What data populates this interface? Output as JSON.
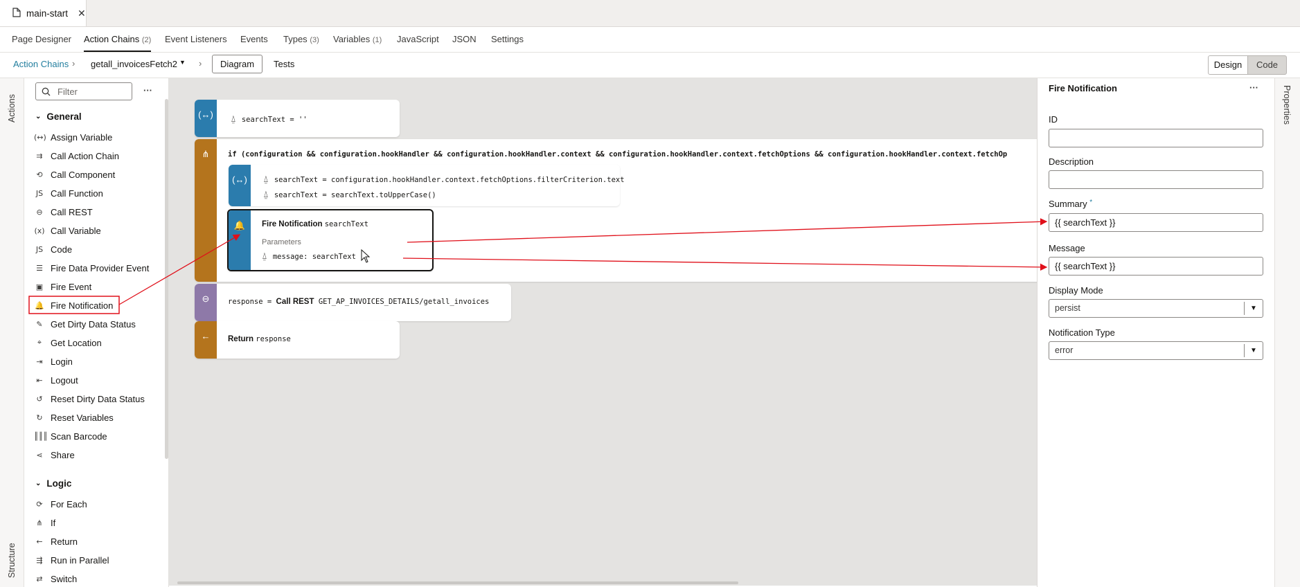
{
  "file_tab": {
    "icon": "file-icon",
    "title": "main-start",
    "close": "✕"
  },
  "nav_tabs": [
    {
      "label": "Page Designer",
      "count": ""
    },
    {
      "label": "Action Chains",
      "count": "(2)"
    },
    {
      "label": "Event Listeners",
      "count": ""
    },
    {
      "label": "Events",
      "count": ""
    },
    {
      "label": "Types",
      "count": "(3)"
    },
    {
      "label": "Variables",
      "count": "(1)"
    },
    {
      "label": "JavaScript",
      "count": ""
    },
    {
      "label": "JSON",
      "count": ""
    },
    {
      "label": "Settings",
      "count": ""
    }
  ],
  "breadcrumb": {
    "root": "Action Chains",
    "chain": "getall_invoicesFetch2",
    "view_diagram": "Diagram",
    "view_tests": "Tests",
    "mode_design": "Design",
    "mode_code": "Code"
  },
  "left_rail": {
    "actions": "Actions",
    "structure": "Structure"
  },
  "palette": {
    "filter_placeholder": "Filter",
    "more": "···",
    "general_title": "General",
    "general_items": [
      {
        "icon": "assign-variable-icon",
        "glyph": "(↔)",
        "label": "Assign Variable"
      },
      {
        "icon": "call-action-chain-icon",
        "glyph": "⇉",
        "label": "Call Action Chain"
      },
      {
        "icon": "call-component-icon",
        "glyph": "⟲",
        "label": "Call Component"
      },
      {
        "icon": "call-function-icon",
        "glyph": "JS",
        "label": "Call Function"
      },
      {
        "icon": "call-rest-icon",
        "glyph": "⊖",
        "label": "Call REST"
      },
      {
        "icon": "call-variable-icon",
        "glyph": "(x)",
        "label": "Call Variable"
      },
      {
        "icon": "code-icon",
        "glyph": "JS",
        "label": "Code"
      },
      {
        "icon": "fire-data-provider-event-icon",
        "glyph": "☰",
        "label": "Fire Data Provider Event"
      },
      {
        "icon": "fire-event-icon",
        "glyph": "▣",
        "label": "Fire Event"
      },
      {
        "icon": "bell-icon",
        "glyph": "🔔",
        "label": "Fire Notification"
      },
      {
        "icon": "get-dirty-data-status-icon",
        "glyph": "✎",
        "label": "Get Dirty Data Status"
      },
      {
        "icon": "location-pin-icon",
        "glyph": "⌖",
        "label": "Get Location"
      },
      {
        "icon": "login-icon",
        "glyph": "⇥",
        "label": "Login"
      },
      {
        "icon": "logout-icon",
        "glyph": "⇤",
        "label": "Logout"
      },
      {
        "icon": "reset-dirty-data-status-icon",
        "glyph": "↺",
        "label": "Reset Dirty Data Status"
      },
      {
        "icon": "reset-variables-icon",
        "glyph": "↻",
        "label": "Reset Variables"
      },
      {
        "icon": "barcode-icon",
        "glyph": "║║║",
        "label": "Scan Barcode"
      },
      {
        "icon": "share-icon",
        "glyph": "⋖",
        "label": "Share"
      }
    ],
    "logic_title": "Logic",
    "logic_items": [
      {
        "icon": "for-each-icon",
        "glyph": "⟳",
        "label": "For Each"
      },
      {
        "icon": "if-icon",
        "glyph": "⋔",
        "label": "If"
      },
      {
        "icon": "return-icon",
        "glyph": "←",
        "label": "Return"
      },
      {
        "icon": "run-in-parallel-icon",
        "glyph": "⇶",
        "label": "Run in Parallel"
      },
      {
        "icon": "switch-icon",
        "glyph": "⇄",
        "label": "Switch"
      }
    ]
  },
  "diagram": {
    "assign1": "searchText = ''",
    "if_condition": "if (configuration && configuration.hookHandler && configuration.hookHandler.context && configuration.hookHandler.context.fetchOptions && configuration.hookHandler.context.fetchOp",
    "assign2_line1": "searchText = configuration.hookHandler.context.fetchOptions.filterCriterion.text",
    "assign2_line2": "searchText = searchText.toUpperCase()",
    "notif_title": "Fire Notification",
    "notif_subject": "searchText",
    "notif_params": "Parameters",
    "notif_message": "message: searchText",
    "rest_prefix": "response = ",
    "rest_keyword": "Call REST",
    "rest_endpoint": "GET_AP_INVOICES_DETAILS/getall_invoices",
    "return_keyword": "Return",
    "return_value": "response"
  },
  "properties": {
    "title": "Fire Notification",
    "more": "···",
    "id_label": "ID",
    "id_value": "",
    "description_label": "Description",
    "description_value": "",
    "summary_label": "Summary",
    "summary_required": "*",
    "summary_value": "{{ searchText }}",
    "message_label": "Message",
    "message_value": "{{ searchText }}",
    "display_mode_label": "Display Mode",
    "display_mode_value": "persist",
    "notification_type_label": "Notification Type",
    "notification_type_value": "error",
    "rail_label": "Properties"
  },
  "colors": {
    "accent_link": "#227e9e",
    "assign_strip": "#2b7cad",
    "if_strip": "#b4741d",
    "rest_strip": "#8e79a8",
    "annotation_red": "#e0101a"
  }
}
